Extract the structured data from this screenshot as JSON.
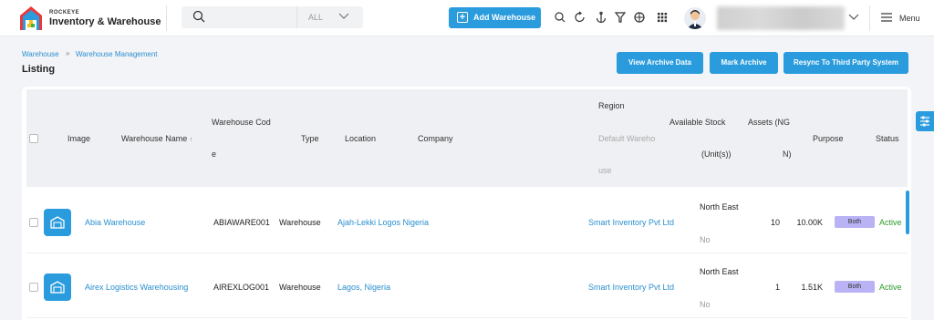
{
  "brand": {
    "top": "ROCKEYE",
    "name": "Inventory & Warehouse"
  },
  "search": {
    "placeholder": "",
    "scope": "ALL"
  },
  "header": {
    "add_label": "Add Warehouse",
    "icons": [
      "search-icon",
      "refresh-icon",
      "anchor-icon",
      "filter-icon",
      "globe-icon",
      "apps-grid-icon"
    ],
    "menu_label": "Menu"
  },
  "breadcrumb": [
    "Warehouse",
    "Warehouse Management"
  ],
  "page_title": "Listing",
  "actions": {
    "view_archive": "View Archive Data",
    "mark_archive": "Mark Archive",
    "resync": "Resync To Third Party System"
  },
  "columns": {
    "image": "Image",
    "name": "Warehouse Name",
    "code_a": "Warehouse Cod",
    "code_b": "e",
    "type": "Type",
    "location": "Location",
    "company": "Company",
    "region": "Region",
    "default_a": "Default Wareho",
    "default_b": "use",
    "stock_a": "Available Stock",
    "stock_b": "(Unit(s))",
    "assets_a": "Assets (NG",
    "assets_b": "N)",
    "purpose": "Purpose",
    "status": "Status"
  },
  "rows": [
    {
      "name": "Abia Warehouse",
      "code": "ABIAWARE001",
      "type": "Warehouse",
      "location": "Ajah-Lekki Logos Nigeria",
      "company": "Smart Inventory Pvt Ltd",
      "region": "North East",
      "default": "No",
      "stock": "10",
      "assets": "10.00K",
      "purpose": "Both",
      "status": "Active"
    },
    {
      "name": "Airex Logistics Warehousing",
      "code": "AIREXLOG001",
      "type": "Warehouse",
      "location": "Lagos, Nigeria",
      "company": "Smart Inventory Pvt Ltd",
      "region": "North East",
      "default": "No",
      "stock": "1",
      "assets": "1.51K",
      "purpose": "Both",
      "status": "Active"
    }
  ],
  "colors": {
    "accent": "#2a9bdc",
    "link": "#2a8fcf",
    "active": "#2a9a2a",
    "badge": "#b9b3f5"
  }
}
